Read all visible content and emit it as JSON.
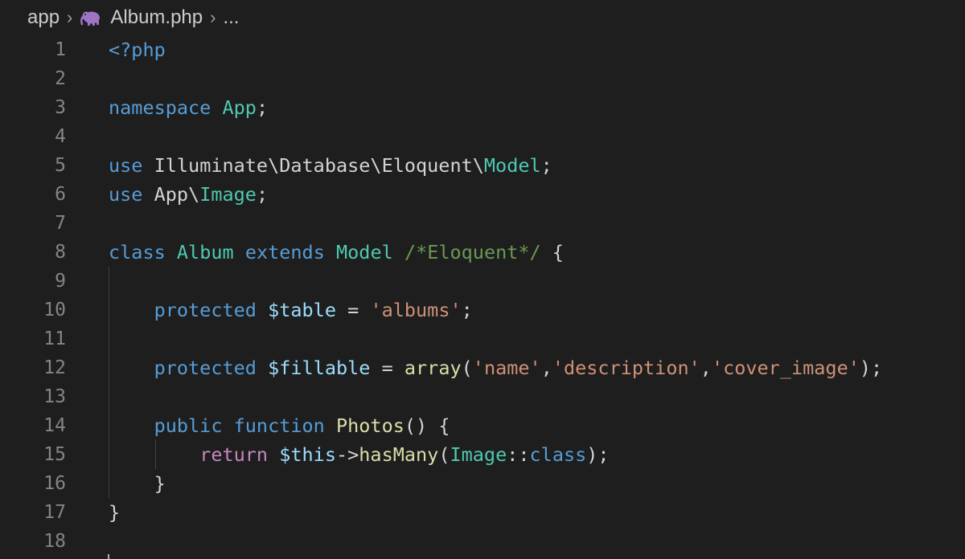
{
  "breadcrumb": {
    "folder": "app",
    "file": "Album.php",
    "more": "...",
    "file_icon": "php-elephant-icon"
  },
  "editor": {
    "line_numbers": [
      "1",
      "2",
      "3",
      "4",
      "5",
      "6",
      "7",
      "8",
      "9",
      "10",
      "11",
      "12",
      "13",
      "14",
      "15",
      "16",
      "17",
      "18"
    ],
    "lines": [
      [
        {
          "t": "<?php",
          "c": "kw"
        }
      ],
      [],
      [
        {
          "t": "namespace",
          "c": "kw"
        },
        {
          "t": " ",
          "c": "plain"
        },
        {
          "t": "App",
          "c": "type"
        },
        {
          "t": ";",
          "c": "plain"
        }
      ],
      [],
      [
        {
          "t": "use",
          "c": "kw"
        },
        {
          "t": " Illuminate\\Database\\Eloquent\\",
          "c": "plain"
        },
        {
          "t": "Model",
          "c": "type"
        },
        {
          "t": ";",
          "c": "plain"
        }
      ],
      [
        {
          "t": "use",
          "c": "kw"
        },
        {
          "t": " App\\",
          "c": "plain"
        },
        {
          "t": "Image",
          "c": "type"
        },
        {
          "t": ";",
          "c": "plain"
        }
      ],
      [],
      [
        {
          "t": "class",
          "c": "kw"
        },
        {
          "t": " ",
          "c": "plain"
        },
        {
          "t": "Album",
          "c": "type"
        },
        {
          "t": " ",
          "c": "plain"
        },
        {
          "t": "extends",
          "c": "kw"
        },
        {
          "t": " ",
          "c": "plain"
        },
        {
          "t": "Model",
          "c": "type"
        },
        {
          "t": " ",
          "c": "plain"
        },
        {
          "t": "/*Eloquent*/",
          "c": "cmt"
        },
        {
          "t": " {",
          "c": "plain"
        }
      ],
      [],
      [
        {
          "t": "    ",
          "c": "plain"
        },
        {
          "t": "protected",
          "c": "kw"
        },
        {
          "t": " ",
          "c": "plain"
        },
        {
          "t": "$table",
          "c": "var"
        },
        {
          "t": " = ",
          "c": "plain"
        },
        {
          "t": "'albums'",
          "c": "str"
        },
        {
          "t": ";",
          "c": "plain"
        }
      ],
      [],
      [
        {
          "t": "    ",
          "c": "plain"
        },
        {
          "t": "protected",
          "c": "kw"
        },
        {
          "t": " ",
          "c": "plain"
        },
        {
          "t": "$fillable",
          "c": "var"
        },
        {
          "t": " = ",
          "c": "plain"
        },
        {
          "t": "array",
          "c": "fn"
        },
        {
          "t": "(",
          "c": "plain"
        },
        {
          "t": "'name'",
          "c": "str"
        },
        {
          "t": ",",
          "c": "plain"
        },
        {
          "t": "'description'",
          "c": "str"
        },
        {
          "t": ",",
          "c": "plain"
        },
        {
          "t": "'cover_image'",
          "c": "str"
        },
        {
          "t": ");",
          "c": "plain"
        }
      ],
      [],
      [
        {
          "t": "    ",
          "c": "plain"
        },
        {
          "t": "public",
          "c": "kw"
        },
        {
          "t": " ",
          "c": "plain"
        },
        {
          "t": "function",
          "c": "kw"
        },
        {
          "t": " ",
          "c": "plain"
        },
        {
          "t": "Photos",
          "c": "fn"
        },
        {
          "t": "() {",
          "c": "plain"
        }
      ],
      [
        {
          "t": "        ",
          "c": "plain"
        },
        {
          "t": "return",
          "c": "ctl"
        },
        {
          "t": " ",
          "c": "plain"
        },
        {
          "t": "$this",
          "c": "var"
        },
        {
          "t": "->",
          "c": "plain"
        },
        {
          "t": "hasMany",
          "c": "fn"
        },
        {
          "t": "(",
          "c": "plain"
        },
        {
          "t": "Image",
          "c": "type"
        },
        {
          "t": "::",
          "c": "plain"
        },
        {
          "t": "class",
          "c": "kw"
        },
        {
          "t": ");",
          "c": "plain"
        }
      ],
      [
        {
          "t": "    }",
          "c": "plain"
        }
      ],
      [
        {
          "t": "}",
          "c": "plain"
        }
      ],
      []
    ]
  },
  "colors": {
    "background": "#1e1e1e",
    "keyword": "#569cd6",
    "control": "#c586c0",
    "type": "#4ec9b0",
    "variable": "#9cdcfe",
    "string": "#ce9178",
    "function": "#dcdcaa",
    "comment": "#6a9955",
    "line_number": "#858585",
    "php_icon": "#a074c4"
  }
}
